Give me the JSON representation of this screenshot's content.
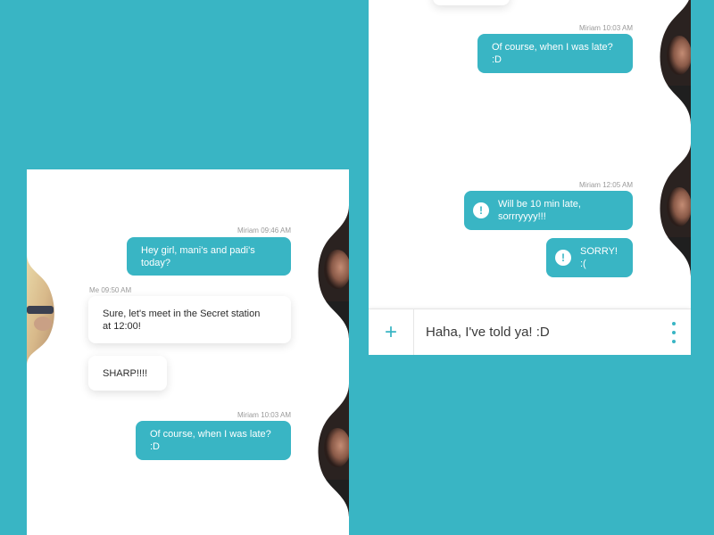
{
  "colors": {
    "accent": "#39b5c4",
    "panel": "#ffffff",
    "meta_text": "#9a9a9a"
  },
  "left_panel": {
    "messages": [
      {
        "sender": "Miriam",
        "time": "Miriam 09:46 AM",
        "text": "Hey girl, mani's and padi's today?",
        "style": "teal"
      },
      {
        "sender": "Me",
        "time": "Me 09:50 AM",
        "text": "Sure, let's meet in the Secret station at 12:00!",
        "style": "white"
      },
      {
        "sender": "Me",
        "time": "",
        "text": "SHARP!!!!",
        "style": "white"
      },
      {
        "sender": "Miriam",
        "time": "Miriam 10:03 AM",
        "text": "Of course, when I was late? :D",
        "style": "teal"
      }
    ]
  },
  "right_panel": {
    "messages": [
      {
        "sender": "Miriam",
        "time": "Miriam 10:03 AM",
        "text": "Of course, when I was late? :D",
        "style": "teal"
      },
      {
        "sender": "Miriam",
        "time": "Miriam 12:05 AM",
        "text": "Will be 10 min late, sorrryyyy!!!",
        "style": "teal",
        "icon": "alert-icon"
      },
      {
        "sender": "Miriam",
        "time": "",
        "text": "SORRY! :(",
        "style": "teal",
        "icon": "alert-icon"
      }
    ],
    "input": {
      "value": "Haha, I've told ya! :D",
      "add_icon": "plus-icon",
      "more_icon": "vertical-dots-icon"
    }
  },
  "icons": {
    "alert_glyph": "!",
    "plus_glyph": "+"
  }
}
